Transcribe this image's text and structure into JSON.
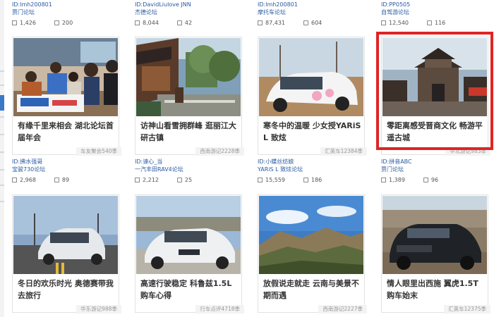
{
  "top_row": [
    {
      "user_id": "ID:lmh200801",
      "forum": "贾门论坛",
      "views": "1,426",
      "replies": "200"
    },
    {
      "user_id": "ID:DavidLiulove JNN",
      "forum": "杰德论坛",
      "views": "8,044",
      "replies": "42"
    },
    {
      "user_id": "ID:lmh200801",
      "forum": "摩托车论坛",
      "views": "87,431",
      "replies": "604"
    },
    {
      "user_id": "ID:PP0505",
      "forum": "自驾游论坛",
      "views": "12,540",
      "replies": "116"
    }
  ],
  "row1": [
    {
      "caption": "有缘千里来相会 湖北论坛首届年会",
      "tag": "车友聚会540季",
      "user_id": "ID:拂水强哥",
      "forum": "宝骏730论坛",
      "views": "2,968",
      "replies": "89"
    },
    {
      "caption": "访神山看雪拥群峰 逛丽江大研古镇",
      "tag": "西南游记2228季",
      "user_id": "ID:谏心_当",
      "forum": "一汽丰田RAV4论坛",
      "views": "2,212",
      "replies": "25"
    },
    {
      "caption": "寒冬中的温暖 少女授YARiS L 致炫",
      "tag": "汇英车12384季",
      "user_id": "ID:小蝶丝纺娘",
      "forum": "YARiS L 致炫论坛",
      "views": "15,559",
      "replies": "186"
    },
    {
      "caption": "零距离感受晋商文化 畅游平遥古城",
      "tag": "华北游记983季",
      "user_id": "ID:拼音ABC",
      "forum": "贾门论坛",
      "views": "1,389",
      "replies": "96"
    }
  ],
  "row2": [
    {
      "caption": "冬日的欢乐时光 奥德赛带我去旅行",
      "tag": "华东游记988季"
    },
    {
      "caption": "高速行驶稳定 科鲁兹1.5L购车心得",
      "tag": "行车点评4718季"
    },
    {
      "caption": "放假说走就走 云南与美景不期而遇",
      "tag": "西南游记2227季"
    },
    {
      "caption": "情人眼里出西施 翼虎1.5T购车始末",
      "tag": "汇英车12375季"
    }
  ],
  "highlight_color": "#e02424",
  "link_color": "#2a5aa0"
}
